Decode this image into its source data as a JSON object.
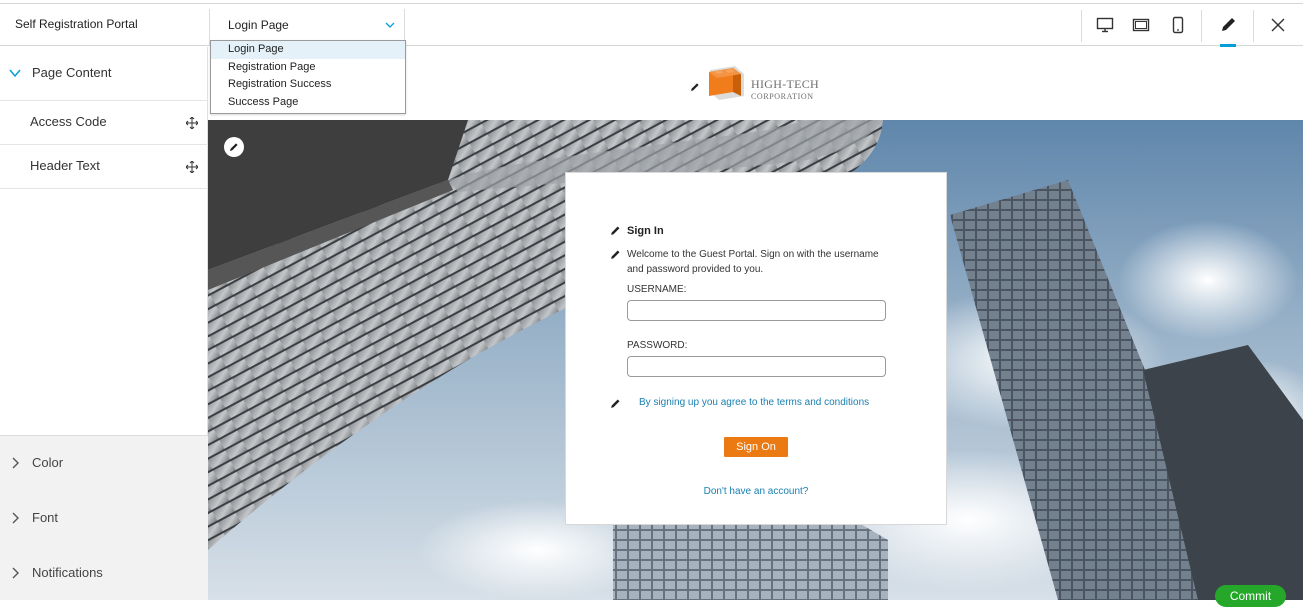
{
  "header": {
    "portal_title": "Self Registration Portal",
    "page_select_value": "Login Page",
    "tools": [
      "desktop-icon",
      "tablet-landscape-icon",
      "mobile-icon",
      "pencil-icon",
      "close-icon"
    ]
  },
  "dropdown": {
    "options": [
      "Login Page",
      "Registration Page",
      "Registration Success",
      "Success Page"
    ],
    "selected": "Login Page"
  },
  "sidebar": {
    "section_label": "Page Content",
    "items": [
      {
        "label": "Access Code"
      },
      {
        "label": "Header Text"
      }
    ],
    "collapsed": [
      {
        "label": "Color"
      },
      {
        "label": "Font"
      },
      {
        "label": "Notifications"
      }
    ]
  },
  "logo": {
    "line1": "HIGH-TECH",
    "line2": "CORPORATION",
    "color": "#f07c1c"
  },
  "signin": {
    "title": "Sign In",
    "welcome": "Welcome to the Guest Portal. Sign on with the username and password provided to you.",
    "username_label": "USERNAME:",
    "password_label": "PASSWORD:",
    "terms": "By signing up you agree to the terms and conditions",
    "button": "Sign On",
    "no_account": "Don't have an account?"
  },
  "commit_label": "Commit",
  "colors": {
    "accent": "#049fd9",
    "button": "#ec7a12",
    "link": "#1a7fb0",
    "commit": "#25a82a"
  }
}
